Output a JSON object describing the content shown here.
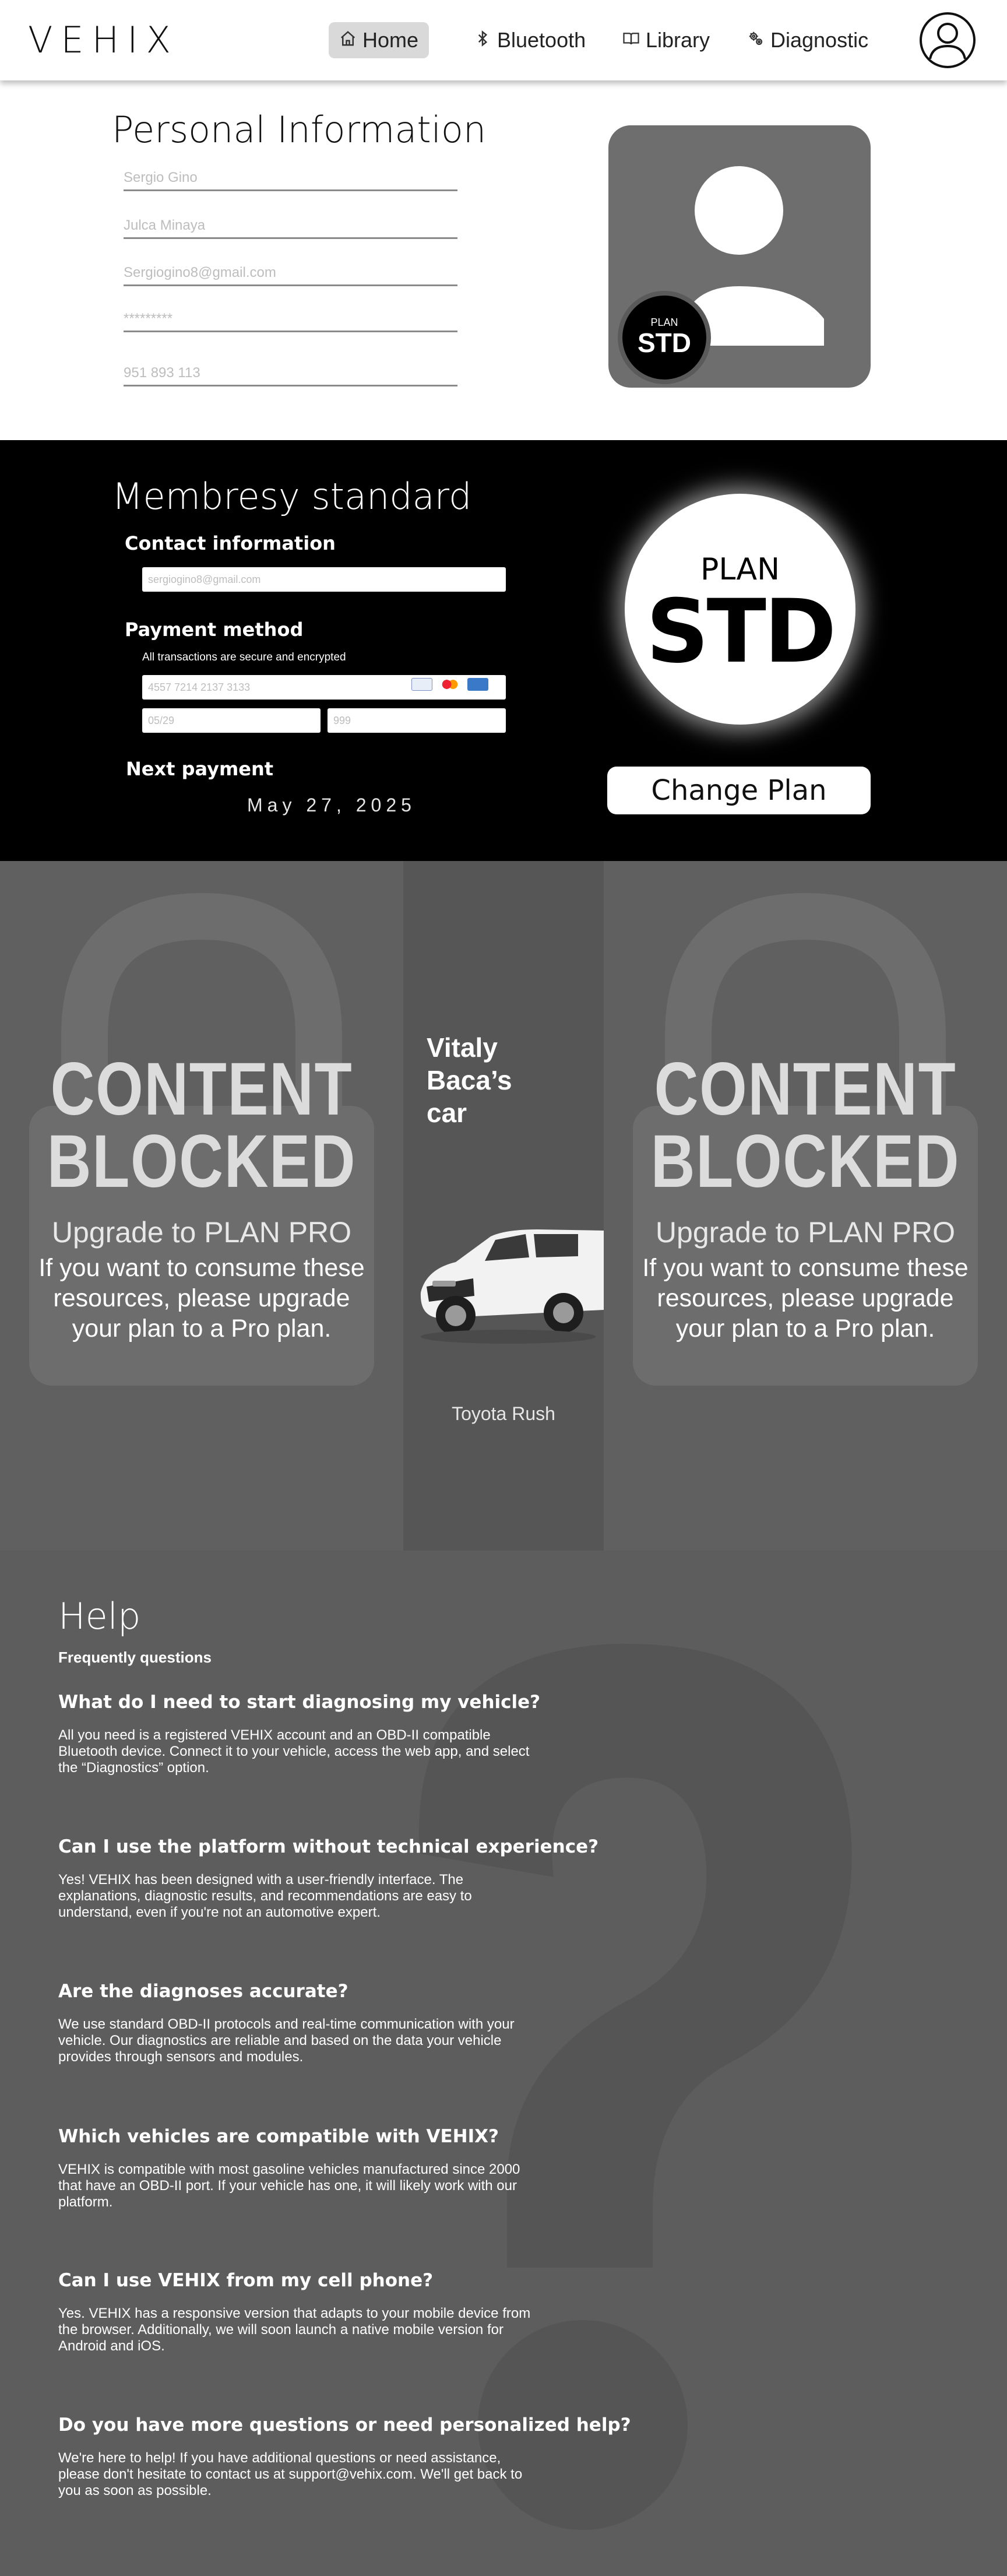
{
  "nav": {
    "logo": "VEHIX",
    "items": [
      {
        "label": "Home",
        "icon": "home-icon",
        "active": true
      },
      {
        "label": "Bluetooth",
        "icon": "bluetooth-icon",
        "active": false
      },
      {
        "label": "Library",
        "icon": "book-icon",
        "active": false
      },
      {
        "label": "Diagnostic",
        "icon": "diagnostic-gears-icon",
        "active": false
      }
    ],
    "profile_icon": "user-circle-icon"
  },
  "personal": {
    "title": "Personal Information",
    "fields": [
      {
        "placeholder": "Sergio Gino"
      },
      {
        "placeholder": "Julca Minaya"
      },
      {
        "placeholder": "Sergiogino8@gmail.com"
      },
      {
        "placeholder": "*********"
      },
      {
        "placeholder": "951 893 113"
      }
    ],
    "badge_plan": "PLAN",
    "badge_code": "STD"
  },
  "membership": {
    "title": "Membresy standard",
    "contact_label": "Contact information",
    "email_placeholder": "sergiogino8@gmail.com",
    "payment_label": "Payment method",
    "secure_note": "All transactions are secure and encrypted",
    "card_placeholder": "4557 7214 2137 3133",
    "expiry_placeholder": "05/29",
    "cvv_placeholder": "999",
    "card_brands": [
      "visa",
      "mastercard",
      "amex"
    ],
    "next_payment_label": "Next payment",
    "next_payment_date": "May 27, 2025",
    "badge_plan": "PLAN",
    "badge_code": "STD",
    "change_plan_label": "Change Plan"
  },
  "blocked": {
    "panels": [
      {
        "line1": "CONTENT",
        "line2": "BLOCKED",
        "upgrade": "Upgrade to PLAN PRO",
        "body": "If you want to consume these resources, please upgrade your plan to a Pro plan."
      },
      {
        "line1": "CONTENT",
        "line2": "BLOCKED",
        "upgrade": "Upgrade to PLAN PRO",
        "body": "If you want to consume these resources, please upgrade your plan to a Pro plan."
      }
    ],
    "car": {
      "title": "Vitaly Baca’s car",
      "model": "Toyota Rush"
    }
  },
  "help": {
    "title": "Help",
    "subtitle": "Frequently questions",
    "faqs": [
      {
        "q": "What do I need to start diagnosing my vehicle?",
        "a": "All you need is a registered VEHIX account and an OBD-II compatible Bluetooth device. Connect it to your vehicle, access the web app, and select the “Diagnostics” option."
      },
      {
        "q": "Can I use the platform without technical experience?",
        "a": "Yes! VEHIX has been designed with a user-friendly interface. The explanations, diagnostic results, and recommendations are easy to understand, even if you're not an automotive expert."
      },
      {
        "q": "Are the diagnoses accurate?",
        "a": "We use standard OBD-II protocols and real-time communication with your vehicle. Our diagnostics are reliable and based on the data your vehicle provides through sensors and modules."
      },
      {
        "q": "Which vehicles are compatible with VEHIX?",
        "a": "VEHIX is compatible with most gasoline vehicles manufactured since 2000 that have an OBD-II port. If your vehicle has one, it will likely work with our platform."
      },
      {
        "q": "Can I use VEHIX from my cell phone?",
        "a": "Yes. VEHIX has a responsive version that adapts to your mobile device from the browser. Additionally, we will soon launch a native mobile version for Android and iOS."
      },
      {
        "q": "Do you have more questions or need personalized help?",
        "a": "We're here to help! If you have additional questions or need assistance, please don't hesitate to contact us at support@vehix.com. We'll get back to you as soon as possible."
      }
    ]
  }
}
